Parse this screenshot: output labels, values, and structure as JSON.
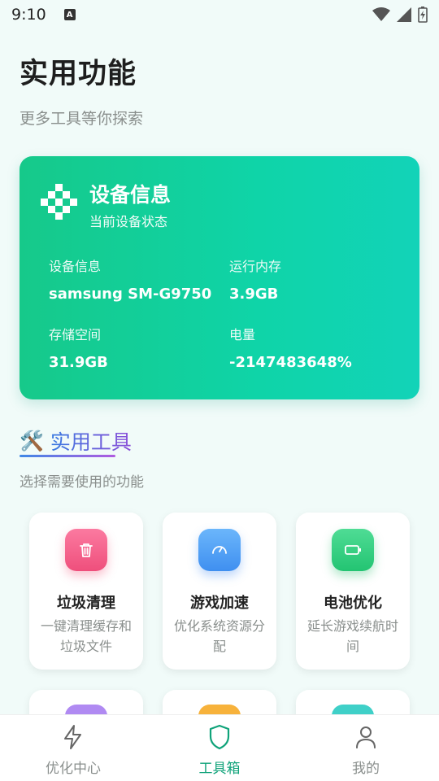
{
  "status_bar": {
    "time": "9:10",
    "notification_letter": "A"
  },
  "header": {
    "title": "实用功能",
    "subtitle": "更多工具等你探索"
  },
  "device_card": {
    "title": "设备信息",
    "subtitle": "当前设备状态",
    "fields": [
      {
        "label": "设备信息",
        "value": "samsung SM-G9750"
      },
      {
        "label": "运行内存",
        "value": "3.9GB"
      },
      {
        "label": "存储空间",
        "value": "31.9GB"
      },
      {
        "label": "电量",
        "value": "-2147483648%"
      }
    ]
  },
  "tools_section": {
    "emoji": "🛠️",
    "title": "实用工具",
    "subtitle": "选择需要使用的功能",
    "tools": [
      {
        "name": "垃圾清理",
        "desc": "一键清理缓存和垃圾文件",
        "icon": "trash-icon",
        "color": "#f25a86"
      },
      {
        "name": "游戏加速",
        "desc": "优化系统资源分配",
        "icon": "speedometer-icon",
        "color": "#4d9ff5"
      },
      {
        "name": "电池优化",
        "desc": "延长游戏续航时间",
        "icon": "battery-icon",
        "color": "#2fce7e"
      }
    ],
    "partial_tools": [
      {
        "icon_color": "#a67cf0"
      },
      {
        "icon_color": "#f5a623"
      },
      {
        "icon_color": "#2ec9c2"
      }
    ]
  },
  "bottom_nav": {
    "items": [
      {
        "label": "优化中心",
        "icon": "lightning-icon",
        "active": false
      },
      {
        "label": "工具箱",
        "icon": "shield-icon",
        "active": true
      },
      {
        "label": "我的",
        "icon": "user-icon",
        "active": false
      }
    ],
    "active_color": "#10a37a"
  }
}
